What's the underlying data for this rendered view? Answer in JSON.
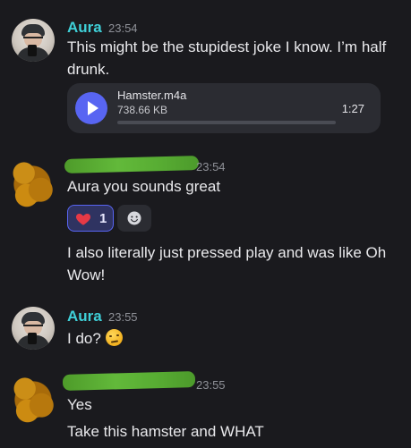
{
  "messages": [
    {
      "author": "Aura",
      "time": "23:54",
      "lines": [
        "This might be the stupidest joke I know. I’m half",
        "drunk."
      ],
      "attachment": {
        "file_name": "Hamster.m4a",
        "file_size": "738.66 KB",
        "duration": "1:27",
        "progress": 0
      }
    },
    {
      "author": "",
      "time": "23:54",
      "text": "Aura you sounds great",
      "reaction": {
        "emoji": "heart-icon",
        "count": "1"
      },
      "followup_lines": [
        "I also literally just pressed play and was like Oh",
        "Wow!"
      ]
    },
    {
      "author": "Aura",
      "time": "23:55",
      "text": "I do?",
      "emoji": "raised-eyebrow-face-icon"
    },
    {
      "author": "",
      "time": "23:55",
      "text": "Yes",
      "followup": "Take this hamster and WHAT"
    }
  ],
  "colors": {
    "background": "#1a1a1e",
    "username_aura": "#3fd0d8",
    "accent": "#5865f2",
    "redaction": "#5aaf36",
    "avatar_scribble": "#c0841a"
  }
}
